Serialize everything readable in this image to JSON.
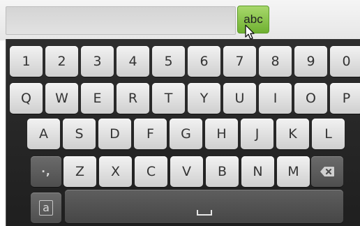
{
  "input": {
    "value": "",
    "placeholder": ""
  },
  "mode_button": {
    "label": "abc"
  },
  "keyboard": {
    "rows": [
      [
        "1",
        "2",
        "3",
        "4",
        "5",
        "6",
        "7",
        "8",
        "9",
        "0"
      ],
      [
        "Q",
        "W",
        "E",
        "R",
        "T",
        "Y",
        "U",
        "I",
        "O",
        "P"
      ],
      [
        "A",
        "S",
        "D",
        "F",
        "G",
        "H",
        "J",
        "K",
        "L"
      ],
      [
        "Z",
        "X",
        "C",
        "V",
        "B",
        "N",
        "M"
      ]
    ],
    "symbols_key": {
      "label": "·,",
      "icon": "punctuation-icon"
    },
    "backspace_key": {
      "icon": "backspace-icon"
    },
    "language_key": {
      "label": "a",
      "icon": "boxed-a-icon"
    },
    "space_key": {
      "icon": "space-bar-icon"
    }
  },
  "colors": {
    "keyboard_bg": "#262626",
    "key_light": "#e6e6e6",
    "key_dark": "#575757",
    "accent_green": "#86c444"
  }
}
